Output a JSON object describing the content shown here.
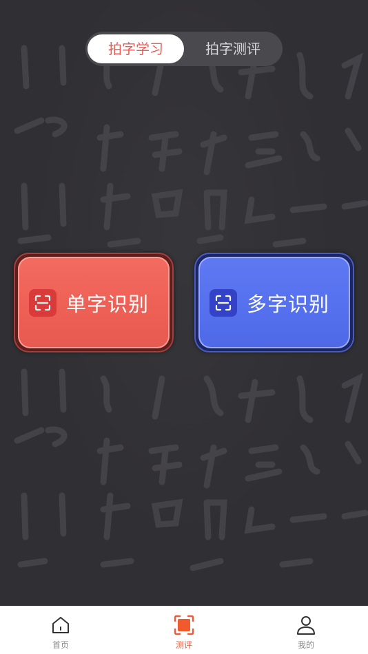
{
  "segmented": {
    "tabs": [
      {
        "label": "拍字学习",
        "active": true
      },
      {
        "label": "拍字测评",
        "active": false
      }
    ]
  },
  "actions": {
    "single": {
      "label": "单字识别",
      "icon": "scan-icon",
      "color": "#ee5f55"
    },
    "multi": {
      "label": "多字识别",
      "icon": "scan-icon",
      "color": "#5570ee"
    }
  },
  "tabbar": {
    "items": [
      {
        "label": "首页",
        "icon": "home-icon",
        "active": false
      },
      {
        "label": "测评",
        "icon": "scan-square-icon",
        "active": true
      },
      {
        "label": "我的",
        "icon": "user-icon",
        "active": false
      }
    ],
    "active_color": "#ef5a3a"
  },
  "background": {
    "color": "#302f33",
    "pattern": "calligraphy-texture"
  }
}
